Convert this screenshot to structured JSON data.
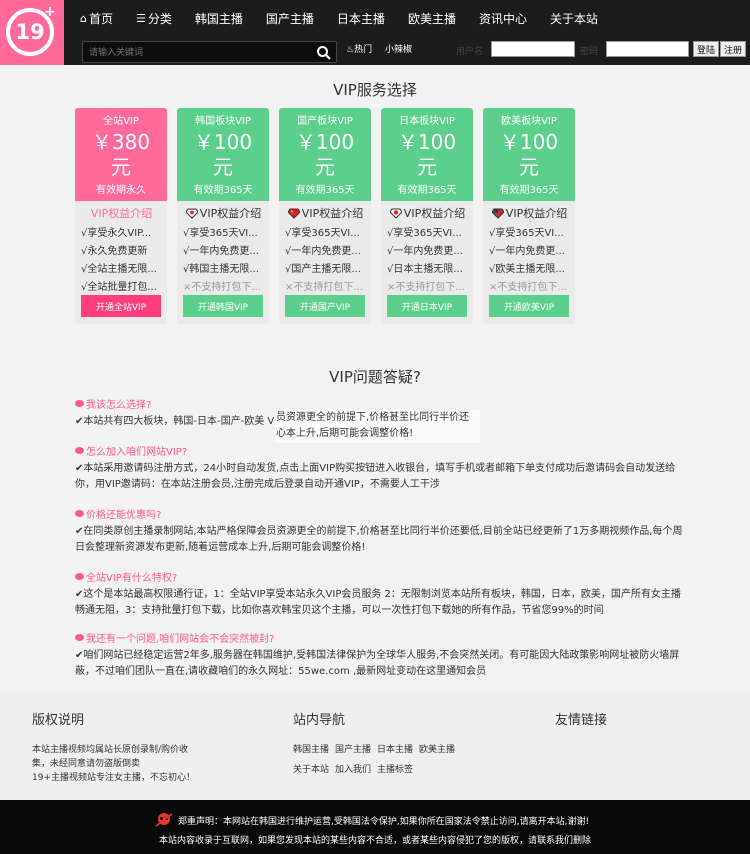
{
  "logo": {
    "text": "19",
    "plus": "+"
  },
  "nav": [
    {
      "icon": "⌂",
      "label": "首页",
      "name": "home"
    },
    {
      "icon": "☰",
      "label": "分类",
      "name": "category"
    },
    {
      "label": "韩国主播",
      "name": "korea"
    },
    {
      "label": "国产主播",
      "name": "china"
    },
    {
      "label": "日本主播",
      "name": "japan"
    },
    {
      "label": "欧美主播",
      "name": "west"
    },
    {
      "label": "资讯中心",
      "name": "news"
    },
    {
      "label": "关于本站",
      "name": "about"
    }
  ],
  "search": {
    "placeholder": "请输入关键词"
  },
  "hot": {
    "hot_label": "热门",
    "spicy_label": "小辣椒"
  },
  "login": {
    "user_label": "用户名",
    "pass_label": "密码",
    "login_btn": "登陆",
    "register_btn": "注册"
  },
  "vip_title": "VIP服务选择",
  "cards": [
    {
      "name": "全站VIP",
      "price": "￥380",
      "unit": "元",
      "valid": "有效期永久",
      "head": "VIP权益介绍",
      "features": [
        "√享受永久VIP...",
        "√永久免费更新",
        "√全站主播无限...",
        "√全站批量打包..."
      ],
      "button": "开通全站VIP"
    },
    {
      "name": "韩国板块VIP",
      "price": "￥100",
      "unit": "元",
      "valid": "有效期365天",
      "head": "VIP权益介绍",
      "features": [
        "√享受365天VI...",
        "√一年内免费更...",
        "√韩国主播无限...",
        "×不支持打包下..."
      ],
      "button": "开通韩国VIP"
    },
    {
      "name": "国产板块VIP",
      "price": "￥100",
      "unit": "元",
      "valid": "有效期365天",
      "head": "VIP权益介绍",
      "features": [
        "√享受365天VI...",
        "√一年内免费更...",
        "√国产主播无限...",
        "×不支持打包下..."
      ],
      "button": "开通国产VIP"
    },
    {
      "name": "日本板块VIP",
      "price": "￥100",
      "unit": "元",
      "valid": "有效期365天",
      "head": "VIP权益介绍",
      "features": [
        "√享受365天VI...",
        "√一年内免费更...",
        "√日本主播无限...",
        "×不支持打包下..."
      ],
      "button": "开通日本VIP"
    },
    {
      "name": "欧美板块VIP",
      "price": "￥100",
      "unit": "元",
      "valid": "有效期365天",
      "head": "VIP权益介绍",
      "features": [
        "√享受365天VI...",
        "√一年内免费更...",
        "√欧美主播无限...",
        "×不支持打包下..."
      ],
      "button": "开通欧美VIP"
    }
  ],
  "faq_title": "VIP问题答疑?",
  "faq": [
    {
      "q": "我该怎么选择?",
      "a": "✔本站共有四大板块，韩国-日本-国产-欧美                                      VIP，开通后即可下载本站所有韩国女主播。"
    },
    {
      "q": "怎么加入咱们网站VIP?",
      "a": "✔本站采用邀请码注册方式，24小时自动发货,点击上面VIP购买按钮进入收银台，填写手机或者邮箱下单支付成功后邀请码会自动发送给你，用VIP邀请码：在本站注册会员,注册完成后登录自动开通VIP，不需要人工干涉"
    },
    {
      "q": "价格还能优惠吗?",
      "a": "✔在同类原创主播录制网站,本站严格保障会员资源更全的前提下,价格甚至比同行半价还要低,目前全站已经更新了1万多期视频作品,每个周日会整理新资源发布更新,随着运营成本上升,后期可能会调整价格!"
    },
    {
      "q": "全站VIP有什么特权?",
      "a": "✔这个是本站最高权限通行证，1：全站VIP享受本站永久VIP会员服务 2：无限制浏览本站所有板块，韩国，日本，欧美，国产所有女主播畅通无阻，3：支持批量打包下载，比如你喜欢韩宝贝这个主播，可以一次性打包下载她的所有作品，节省您99%的时间"
    },
    {
      "q": "我还有一个问题,咱们网站会不会突然被封?",
      "a": "✔咱们网站已经稳定运营2年多,服务器在韩国维护,受韩国法律保护为全球华人服务,不会突然关闭。有可能因大陆政策影响网址被防火墙屏蔽，不过咱们团队一直在,请收藏咱们的永久网址：55we.com ,最新网址变动在这里通知会员"
    }
  ],
  "overlay_text": [
    "员资源更全的前提下,价格甚至比同行半价还",
    "心本上升,后期可能会调整价格!"
  ],
  "footer": {
    "copyright_title": "版权说明",
    "copyright_text": [
      "本站主播视频均属站长原创录制/购价收",
      "集，未经同意请勿盗版倒卖",
      "19+主播视频站专注女主播，不忘初心！"
    ],
    "nav_title": "站内导航",
    "nav_links_1": [
      "韩国主播",
      "国产主播",
      "日本主播",
      "欧美主播"
    ],
    "nav_links_2": [
      "关于本站",
      "加入我们",
      "主播标签"
    ],
    "friend_title": "友情链接"
  },
  "disclaimer": {
    "line1": "郑重声明：本网站在韩国进行维护运营,受韩国法令保护,如果你所在国家法令禁止访问,请离开本站,谢谢!",
    "line2": "本站内容收录于互联网，如果您发现本站的某些内容不合适，或者某些内容侵犯了您的版权，请联系我们删除"
  },
  "colors": {
    "pink": "#ff6a9b",
    "green": "#5ccf8c",
    "header_bg": "#1c1c1c"
  }
}
